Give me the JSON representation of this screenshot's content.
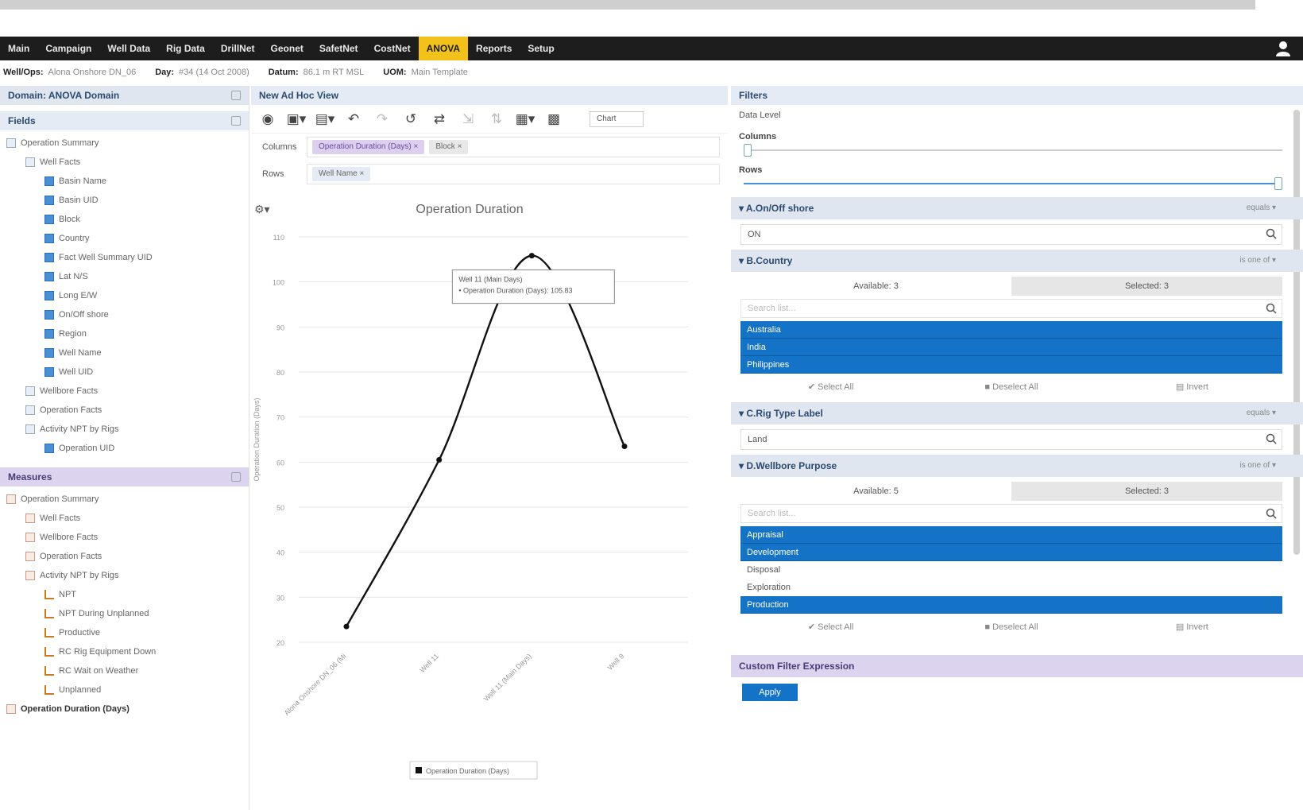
{
  "menu": {
    "items": [
      "Main",
      "Campaign",
      "Well Data",
      "Rig Data",
      "DrillNet",
      "Geonet",
      "SafetNet",
      "CostNet",
      "ANOVA",
      "Reports",
      "Setup"
    ],
    "active": "ANOVA"
  },
  "wellbar": {
    "well_label": "Well/Ops:",
    "well_value": "Alona Onshore DN_06",
    "day_label": "Day:",
    "day_value": "#34 (14 Oct 2008)",
    "datum_label": "Datum:",
    "datum_value": "86.1 m RT MSL",
    "uom_label": "UOM:",
    "uom_value": "Main Template"
  },
  "left": {
    "domain_title": "Domain: ANOVA Domain",
    "fields_title": "Fields",
    "fields_tree": [
      {
        "label": "Operation Summary",
        "type": "folder",
        "indent": 0
      },
      {
        "label": "Well Facts",
        "type": "folder",
        "indent": 1
      },
      {
        "label": "Basin Name",
        "type": "field",
        "indent": 2
      },
      {
        "label": "Basin UID",
        "type": "field",
        "indent": 2
      },
      {
        "label": "Block",
        "type": "field",
        "indent": 2
      },
      {
        "label": "Country",
        "type": "field",
        "indent": 2
      },
      {
        "label": "Fact Well Summary UID",
        "type": "field",
        "indent": 2
      },
      {
        "label": "Lat N/S",
        "type": "field",
        "indent": 2
      },
      {
        "label": "Long E/W",
        "type": "field",
        "indent": 2
      },
      {
        "label": "On/Off shore",
        "type": "field",
        "indent": 2
      },
      {
        "label": "Region",
        "type": "field",
        "indent": 2
      },
      {
        "label": "Well Name",
        "type": "field",
        "indent": 2
      },
      {
        "label": "Well UID",
        "type": "field",
        "indent": 2
      },
      {
        "label": "Wellbore Facts",
        "type": "folder",
        "indent": 1
      },
      {
        "label": "Operation Facts",
        "type": "folder",
        "indent": 1
      },
      {
        "label": "Activity NPT by Rigs",
        "type": "folder",
        "indent": 1
      },
      {
        "label": "Operation UID",
        "type": "field",
        "indent": 2
      }
    ],
    "measures_title": "Measures",
    "measures_tree": [
      {
        "label": "Operation Summary",
        "type": "mfolder",
        "indent": 0
      },
      {
        "label": "Well Facts",
        "type": "mfolder",
        "indent": 1
      },
      {
        "label": "Wellbore Facts",
        "type": "mfolder",
        "indent": 1
      },
      {
        "label": "Operation Facts",
        "type": "mfolder",
        "indent": 1
      },
      {
        "label": "Activity NPT by Rigs",
        "type": "mfolder",
        "indent": 1
      },
      {
        "label": "NPT",
        "type": "meas",
        "indent": 2
      },
      {
        "label": "NPT During Unplanned",
        "type": "meas",
        "indent": 2
      },
      {
        "label": "Productive",
        "type": "meas",
        "indent": 2
      },
      {
        "label": "RC Rig Equipment Down",
        "type": "meas",
        "indent": 2
      },
      {
        "label": "RC Wait on Weather",
        "type": "meas",
        "indent": 2
      },
      {
        "label": "Unplanned",
        "type": "meas",
        "indent": 2
      },
      {
        "label": "Operation Duration (Days)",
        "type": "mfolder",
        "indent": 0,
        "bold": true
      }
    ]
  },
  "center": {
    "title": "New Ad Hoc View",
    "chart_type_value": "Chart",
    "columns_label": "Columns",
    "columns_pills": [
      "Operation Duration (Days)",
      "Block"
    ],
    "rows_label": "Rows",
    "rows_pills": [
      "Well Name"
    ],
    "tooltip_line1": "Well 11 (Main Days)",
    "tooltip_line2": "• Operation Duration (Days): 105.83"
  },
  "chart_data": {
    "type": "line",
    "title": "Operation Duration",
    "ylabel": "Operation Duration (Days)",
    "xlabel": "",
    "categories": [
      "Alona Onshore DN_06 (Mi",
      "Well 11",
      "Well 11 (Main Days)",
      "Well 9"
    ],
    "series": [
      {
        "name": "Operation Duration (Days)",
        "values": [
          23.5,
          60.5,
          105.83,
          63.5
        ]
      }
    ],
    "ylim": [
      20,
      110
    ],
    "yticks": [
      20,
      30,
      40,
      50,
      60,
      70,
      80,
      90,
      100,
      110
    ],
    "grid": true,
    "legend": "bottom",
    "line_color": "#111111"
  },
  "right": {
    "title": "Filters",
    "data_level": "Data Level",
    "columns_label": "Columns",
    "rows_label": "Rows",
    "columns_slider": 0.0,
    "rows_slider": 1.0,
    "filters": [
      {
        "kind": "search",
        "title": "A.On/Off shore",
        "op": "equals ▾",
        "value": "ON"
      },
      {
        "kind": "list",
        "title": "B.Country",
        "op": "is one of ▾",
        "available": "Available: 3",
        "selected": "Selected: 3",
        "search_placeholder": "Search list...",
        "items": [
          {
            "label": "Australia",
            "sel": true
          },
          {
            "label": "India",
            "sel": true
          },
          {
            "label": "Philippines",
            "sel": true
          }
        ],
        "select_all": "✔ Select All",
        "deselect_all": "■ Deselect All",
        "invert": "▤ Invert"
      },
      {
        "kind": "search",
        "title": "C.Rig Type Label",
        "op": "equals ▾",
        "value": "Land"
      },
      {
        "kind": "list",
        "title": "D.Wellbore Purpose",
        "op": "is one of ▾",
        "available": "Available: 5",
        "selected": "Selected: 3",
        "search_placeholder": "Search list...",
        "items": [
          {
            "label": "Appraisal",
            "sel": true
          },
          {
            "label": "Development",
            "sel": true
          },
          {
            "label": "Disposal",
            "sel": false
          },
          {
            "label": "Exploration",
            "sel": false
          },
          {
            "label": "Production",
            "sel": true
          }
        ],
        "select_all": "✔ Select All",
        "deselect_all": "■ Deselect All",
        "invert": "▤ Invert"
      }
    ],
    "custom_title": "Custom Filter Expression",
    "apply_label": "Apply"
  },
  "colors": {
    "menubar": "#1d1d1d",
    "menu_active": "#f2c21a",
    "selected_item": "#1573c7",
    "panel_header": "#dfe6ef",
    "measures_header": "#dcd3ee"
  }
}
